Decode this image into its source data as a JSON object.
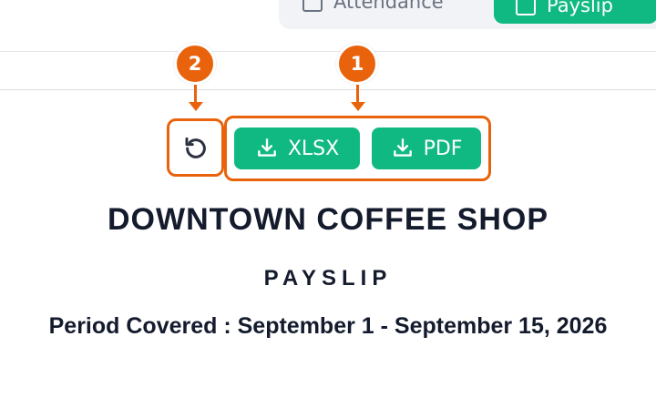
{
  "tabs": {
    "attendance_label": "Attendance",
    "payslip_label": "Payslip"
  },
  "callouts": {
    "one": "1",
    "two": "2"
  },
  "actions": {
    "refresh_icon": "refresh-icon",
    "xlsx_label": "XLSX",
    "pdf_label": "PDF"
  },
  "payslip": {
    "company_name": "DOWNTOWN COFFEE SHOP",
    "title": "PAYSLIP",
    "period_label": "Period Covered : September 1 - September 15, 2026"
  },
  "colors": {
    "accent_green": "#10b981",
    "callout_orange": "#e8630c",
    "text_dark": "#141b2d"
  }
}
